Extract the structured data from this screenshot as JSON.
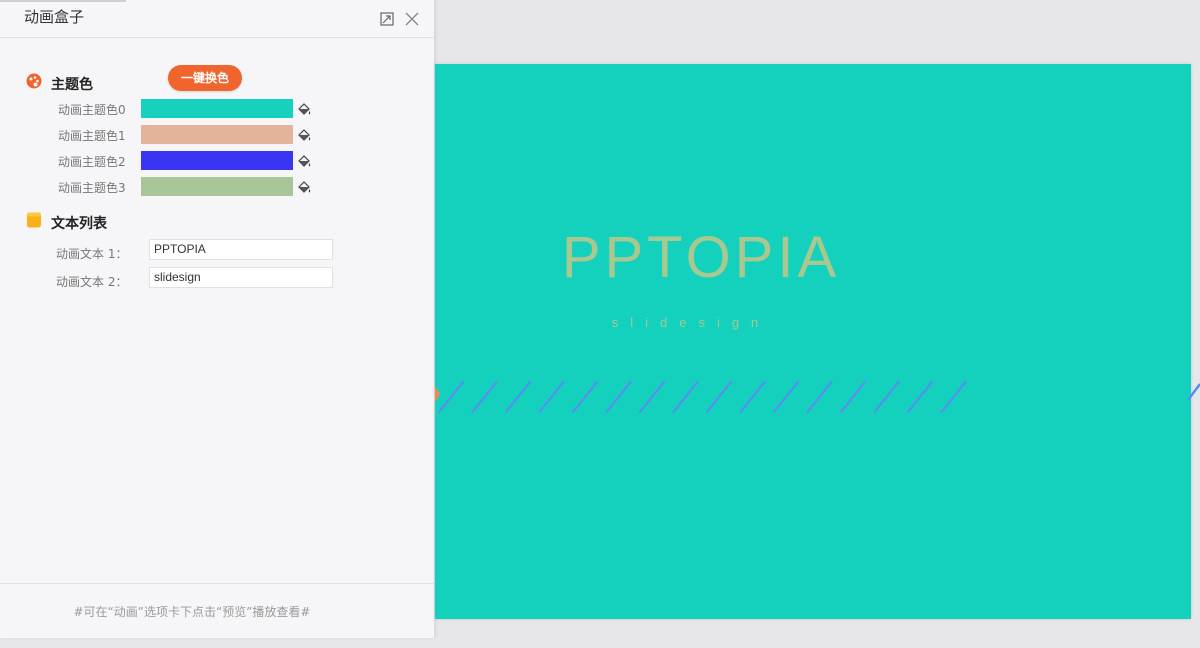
{
  "panel": {
    "title": "动画盒子",
    "pin_icon": "pin-icon",
    "close_icon": "close-icon",
    "theme_section": {
      "title": "主题色",
      "icon": "palette-icon",
      "recolor_button": "一键换色",
      "colors": [
        {
          "label": "动画主题色0",
          "value": "#17d0bd"
        },
        {
          "label": "动画主题色1",
          "value": "#e4b49a"
        },
        {
          "label": "动画主题色2",
          "value": "#3a35f2"
        },
        {
          "label": "动画主题色3",
          "value": "#a9c69a"
        }
      ]
    },
    "text_section": {
      "title": "文本列表",
      "icon": "document-icon",
      "items": [
        {
          "label": "动画文本 1：",
          "value": "PPTOPIA"
        },
        {
          "label": "动画文本 2：",
          "value": "slidesign"
        }
      ]
    },
    "footer_hint": "#可在“动画”选项卡下点击“预览”播放查看#"
  },
  "slide": {
    "background": "#14d1be",
    "title_text": "PPTOPIA",
    "subtitle_text": "slidesign",
    "title_color": "#a8c88f",
    "stripe_color": "#5a8df2",
    "accent_color": "#f0885a"
  }
}
